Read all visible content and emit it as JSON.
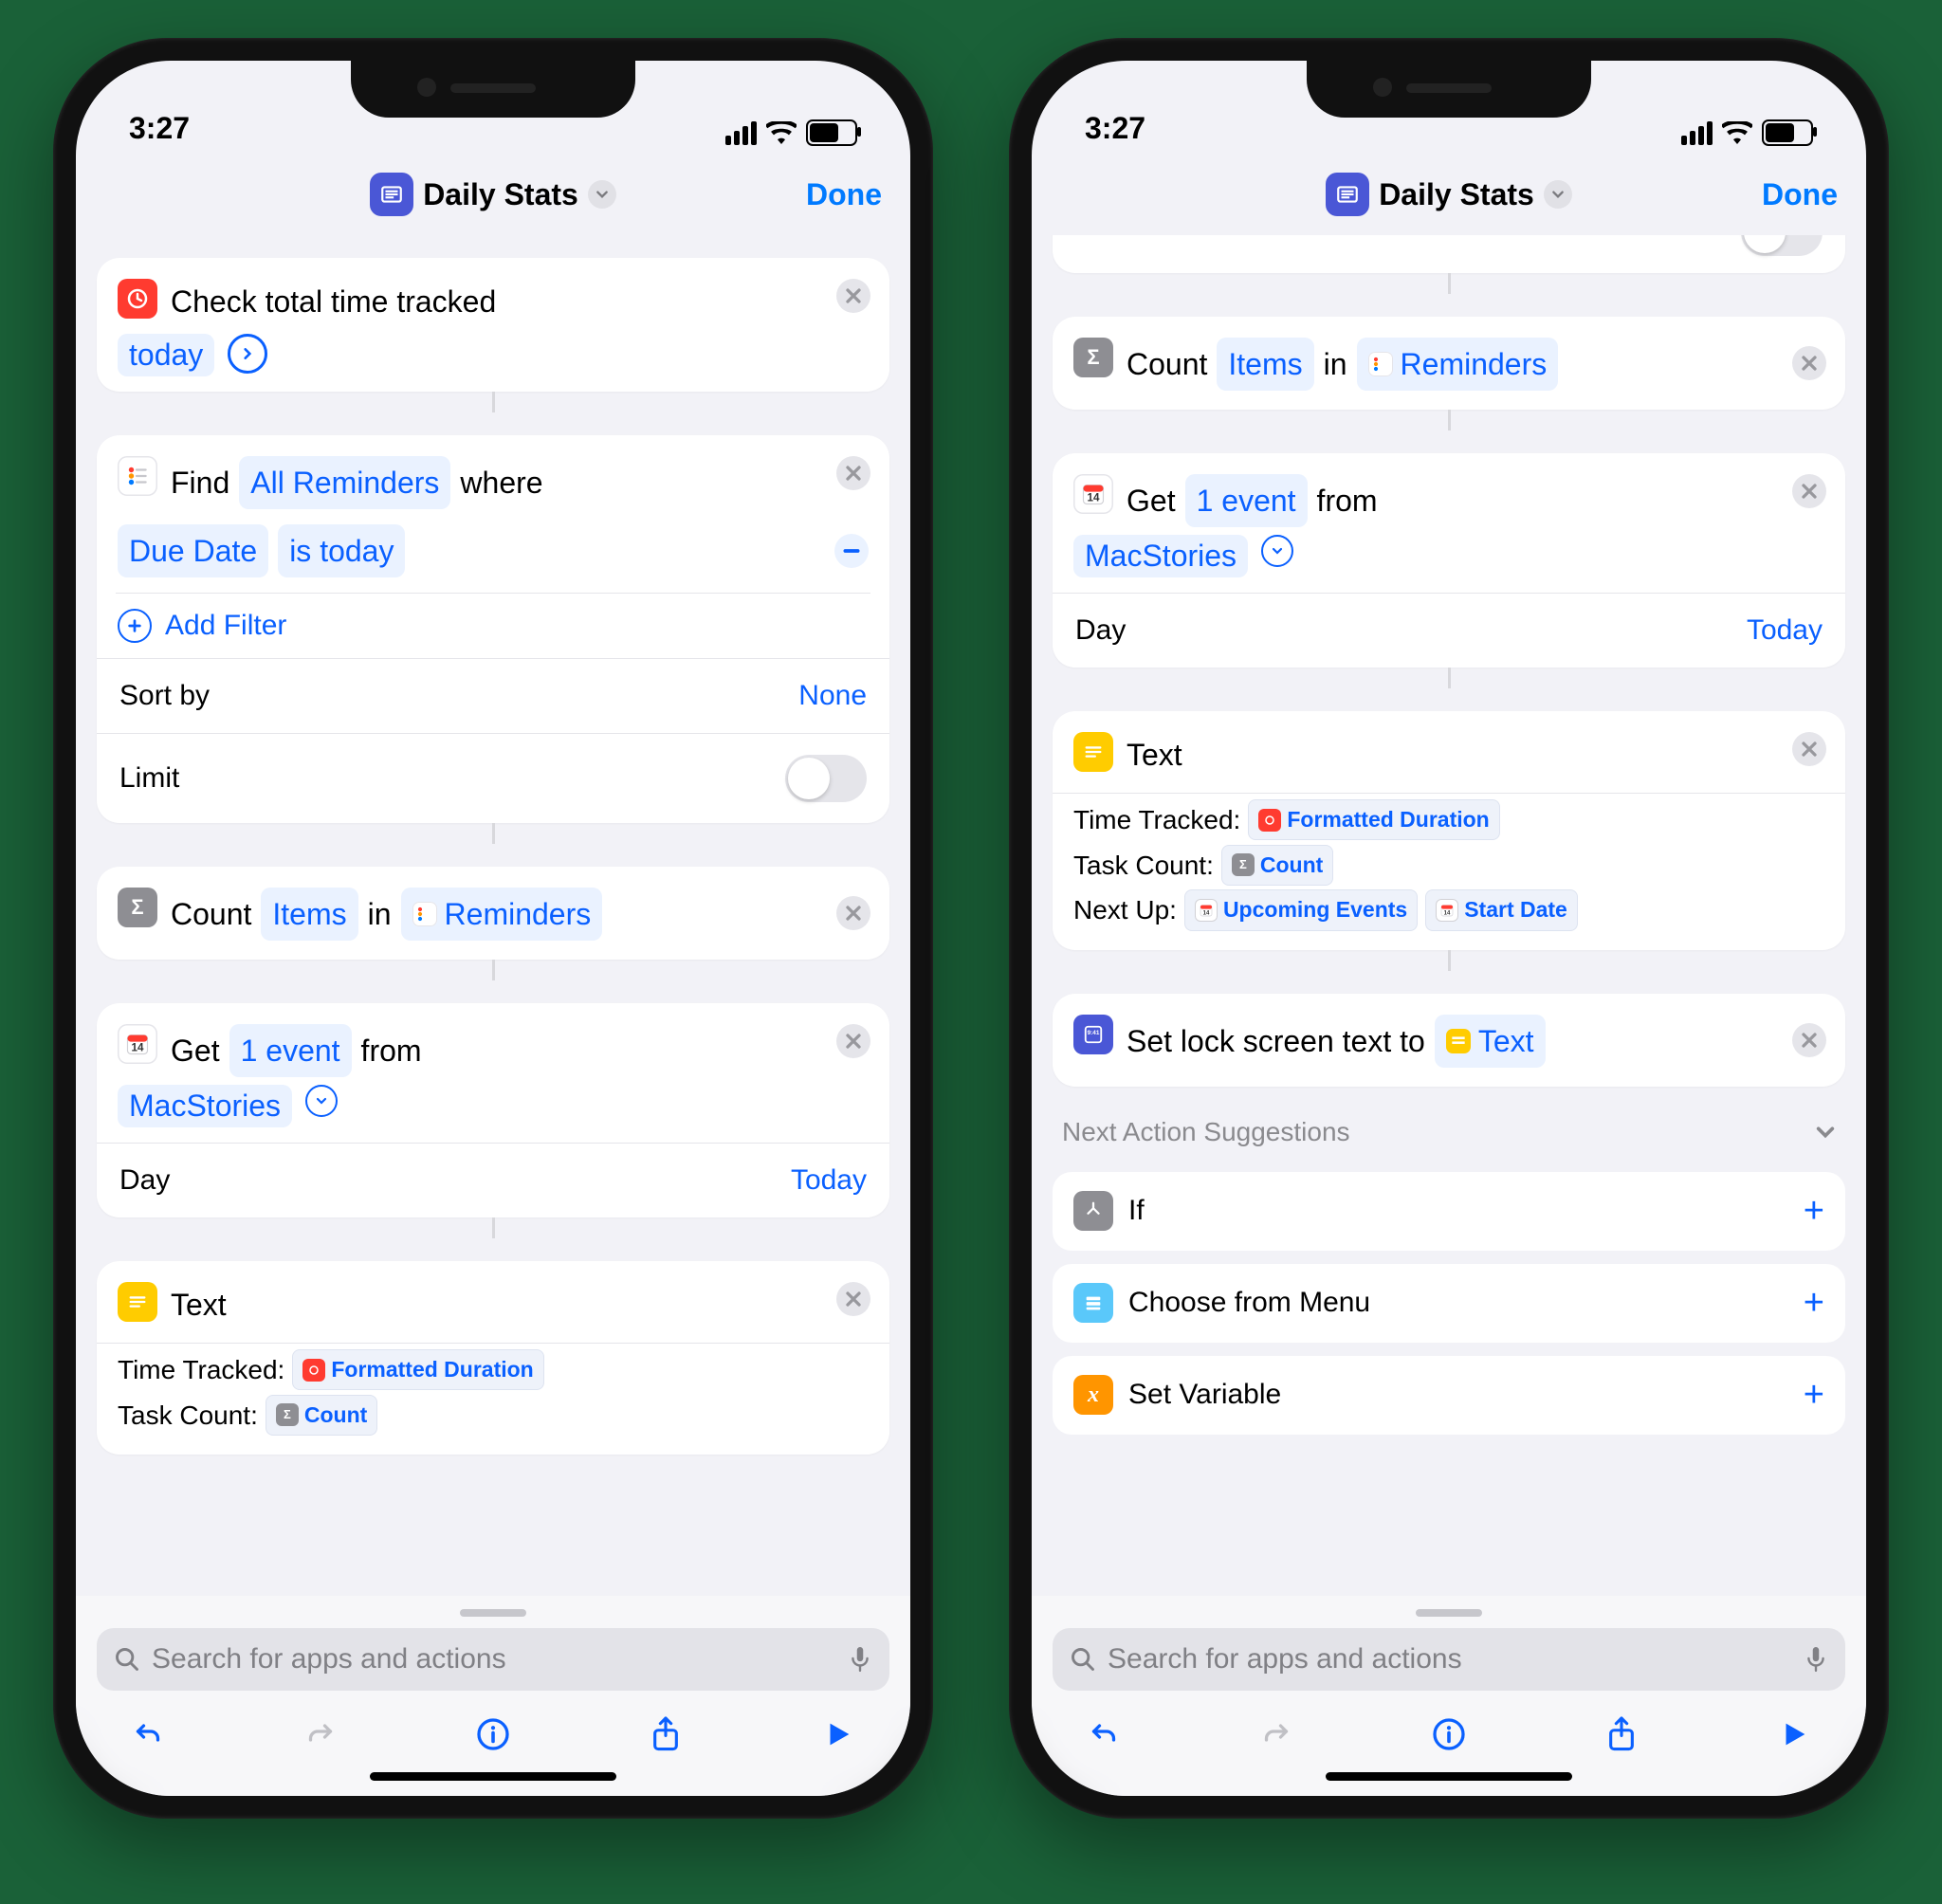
{
  "status": {
    "time": "3:27"
  },
  "nav": {
    "title": "Daily Stats",
    "done": "Done"
  },
  "search": {
    "placeholder": "Search for apps and actions"
  },
  "left": {
    "a1": {
      "line": "Check total time tracked",
      "pill": "today"
    },
    "a2": {
      "prefix": "Find",
      "pill1": "All Reminders",
      "suffix": "where",
      "filter_field": "Due Date",
      "filter_cond": "is today",
      "add_filter": "Add Filter",
      "sort_label": "Sort by",
      "sort_value": "None",
      "limit_label": "Limit"
    },
    "a3": {
      "prefix": "Count",
      "pill1": "Items",
      "mid": "in",
      "pill2": "Reminders"
    },
    "a4": {
      "prefix": "Get",
      "pill1": "1 event",
      "mid": "from",
      "pill2": "MacStories",
      "day_label": "Day",
      "day_value": "Today"
    },
    "a5": {
      "title": "Text",
      "l1_label": "Time Tracked:",
      "l1_var": "Formatted Duration",
      "l2_label": "Task Count:",
      "l2_var": "Count"
    }
  },
  "right": {
    "a3": {
      "prefix": "Count",
      "pill1": "Items",
      "mid": "in",
      "pill2": "Reminders"
    },
    "a4": {
      "prefix": "Get",
      "pill1": "1 event",
      "mid": "from",
      "pill2": "MacStories",
      "day_label": "Day",
      "day_value": "Today"
    },
    "a5": {
      "title": "Text",
      "l1_label": "Time Tracked:",
      "l1_var": "Formatted Duration",
      "l2_label": "Task Count:",
      "l2_var": "Count",
      "l3_label": "Next Up:",
      "l3_var1": "Upcoming Events",
      "l3_var2": "Start Date"
    },
    "a6": {
      "prefix": "Set lock screen text to",
      "pill": "Text"
    },
    "sugg": {
      "header": "Next Action Suggestions",
      "s1": "If",
      "s2": "Choose from Menu",
      "s3": "Set Variable"
    }
  }
}
